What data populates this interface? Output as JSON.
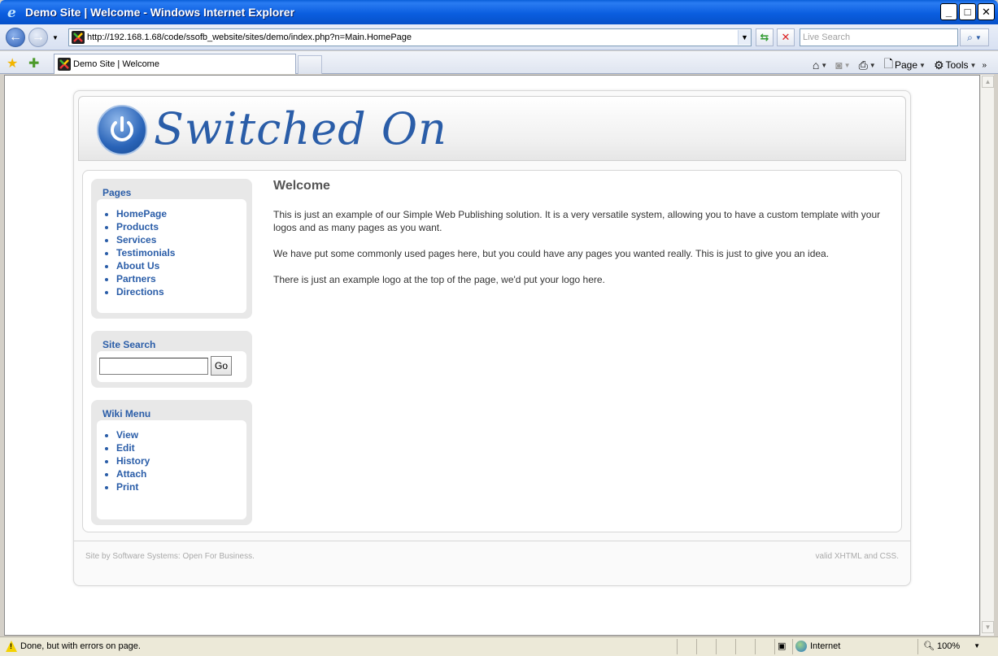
{
  "window": {
    "title": "Demo Site | Welcome - Windows Internet Explorer"
  },
  "navbar": {
    "url": "http://192.168.1.68/code/ssofb_website/sites/demo/index.php?n=Main.HomePage",
    "search_placeholder": "Live Search"
  },
  "tabs": [
    {
      "label": "Demo Site | Welcome"
    }
  ],
  "commandbar": {
    "page_label": "Page",
    "tools_label": "Tools"
  },
  "site": {
    "logo_text": "Switched On",
    "pages_box": {
      "title": "Pages",
      "items": [
        "HomePage",
        "Products",
        "Services",
        "Testimonials",
        "About Us",
        "Partners",
        "Directions"
      ]
    },
    "search_box": {
      "title": "Site Search",
      "button_label": "Go"
    },
    "wiki_box": {
      "title": "Wiki Menu",
      "items": [
        "View",
        "Edit",
        "History",
        "Attach",
        "Print"
      ]
    },
    "content": {
      "heading": "Welcome",
      "paragraphs": [
        "This is just an example of our Simple Web Publishing solution. It is a very versatile system, allowing you to have a custom template with your logos and as many pages as you want.",
        "We have put some commonly used pages here, but you could have any pages you wanted really. This is just to give you an idea.",
        "There is just an example logo at the top of the page, we'd put your logo here."
      ]
    },
    "footer": {
      "left": "Site by Software Systems: Open For Business.",
      "right": "valid XHTML and CSS."
    }
  },
  "statusbar": {
    "message": "Done, but with errors on page.",
    "zone": "Internet",
    "zoom": "100%"
  }
}
